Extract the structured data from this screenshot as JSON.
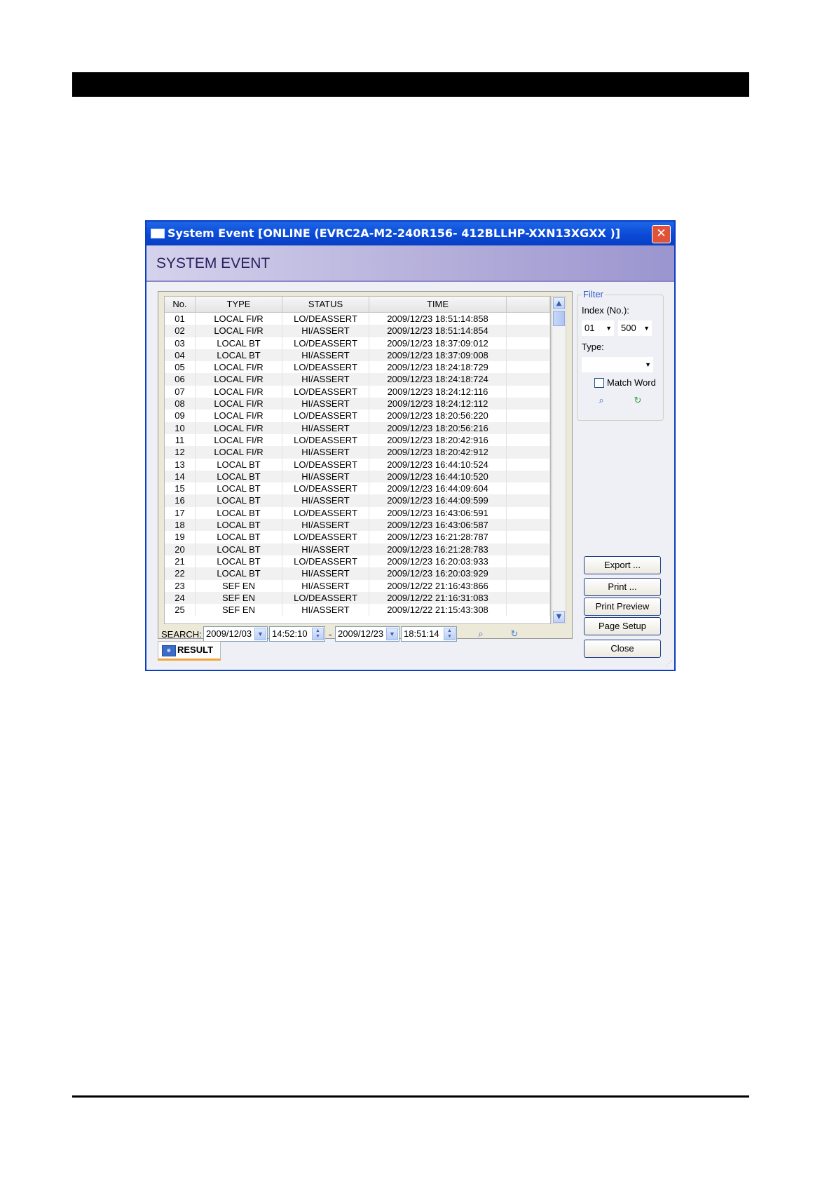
{
  "window": {
    "title": "System Event [ONLINE (EVRC2A-M2-240R156-  412BLLHP-XXN13XGXX )]",
    "close_glyph": "✕",
    "heading": "SYSTEM EVENT"
  },
  "table": {
    "columns": [
      "No.",
      "TYPE",
      "STATUS",
      "TIME"
    ],
    "rows": [
      [
        "01",
        "LOCAL FI/R",
        "LO/DEASSERT",
        "2009/12/23 18:51:14:858"
      ],
      [
        "02",
        "LOCAL FI/R",
        "HI/ASSERT",
        "2009/12/23 18:51:14:854"
      ],
      [
        "03",
        "LOCAL BT",
        "LO/DEASSERT",
        "2009/12/23 18:37:09:012"
      ],
      [
        "04",
        "LOCAL BT",
        "HI/ASSERT",
        "2009/12/23 18:37:09:008"
      ],
      [
        "05",
        "LOCAL FI/R",
        "LO/DEASSERT",
        "2009/12/23 18:24:18:729"
      ],
      [
        "06",
        "LOCAL FI/R",
        "HI/ASSERT",
        "2009/12/23 18:24:18:724"
      ],
      [
        "07",
        "LOCAL FI/R",
        "LO/DEASSERT",
        "2009/12/23 18:24:12:116"
      ],
      [
        "08",
        "LOCAL FI/R",
        "HI/ASSERT",
        "2009/12/23 18:24:12:112"
      ],
      [
        "09",
        "LOCAL FI/R",
        "LO/DEASSERT",
        "2009/12/23 18:20:56:220"
      ],
      [
        "10",
        "LOCAL FI/R",
        "HI/ASSERT",
        "2009/12/23 18:20:56:216"
      ],
      [
        "11",
        "LOCAL FI/R",
        "LO/DEASSERT",
        "2009/12/23 18:20:42:916"
      ],
      [
        "12",
        "LOCAL FI/R",
        "HI/ASSERT",
        "2009/12/23 18:20:42:912"
      ],
      [
        "13",
        "LOCAL BT",
        "LO/DEASSERT",
        "2009/12/23 16:44:10:524"
      ],
      [
        "14",
        "LOCAL BT",
        "HI/ASSERT",
        "2009/12/23 16:44:10:520"
      ],
      [
        "15",
        "LOCAL BT",
        "LO/DEASSERT",
        "2009/12/23 16:44:09:604"
      ],
      [
        "16",
        "LOCAL BT",
        "HI/ASSERT",
        "2009/12/23 16:44:09:599"
      ],
      [
        "17",
        "LOCAL BT",
        "LO/DEASSERT",
        "2009/12/23 16:43:06:591"
      ],
      [
        "18",
        "LOCAL BT",
        "HI/ASSERT",
        "2009/12/23 16:43:06:587"
      ],
      [
        "19",
        "LOCAL BT",
        "LO/DEASSERT",
        "2009/12/23 16:21:28:787"
      ],
      [
        "20",
        "LOCAL BT",
        "HI/ASSERT",
        "2009/12/23 16:21:28:783"
      ],
      [
        "21",
        "LOCAL BT",
        "LO/DEASSERT",
        "2009/12/23 16:20:03:933"
      ],
      [
        "22",
        "LOCAL BT",
        "HI/ASSERT",
        "2009/12/23 16:20:03:929"
      ],
      [
        "23",
        "SEF EN",
        "HI/ASSERT",
        "2009/12/22 21:16:43:866"
      ],
      [
        "24",
        "SEF EN",
        "LO/DEASSERT",
        "2009/12/22 21:16:31:083"
      ],
      [
        "25",
        "SEF EN",
        "HI/ASSERT",
        "2009/12/22 21:15:43:308"
      ]
    ]
  },
  "search": {
    "label": "SEARCH:",
    "from_date": "2009/12/03",
    "from_time": "14:52:10",
    "separator": "-",
    "to_date": "2009/12/23",
    "to_time": "18:51:14"
  },
  "result_tab": {
    "label": "RESULT"
  },
  "filter": {
    "legend": "Filter",
    "index_label": "Index (No.):",
    "index_from": "01",
    "index_to": "500",
    "type_label": "Type:",
    "type_value": "",
    "match_word_label": "Match Word"
  },
  "buttons": {
    "export": "Export ...",
    "print": "Print ...",
    "print_preview": "Print Preview",
    "page_setup": "Page Setup",
    "close": "Close"
  },
  "colors": {
    "titlebar": "#0a48d4",
    "accent_tab": "#f2a53a",
    "filter_legend": "#2a55c8"
  }
}
